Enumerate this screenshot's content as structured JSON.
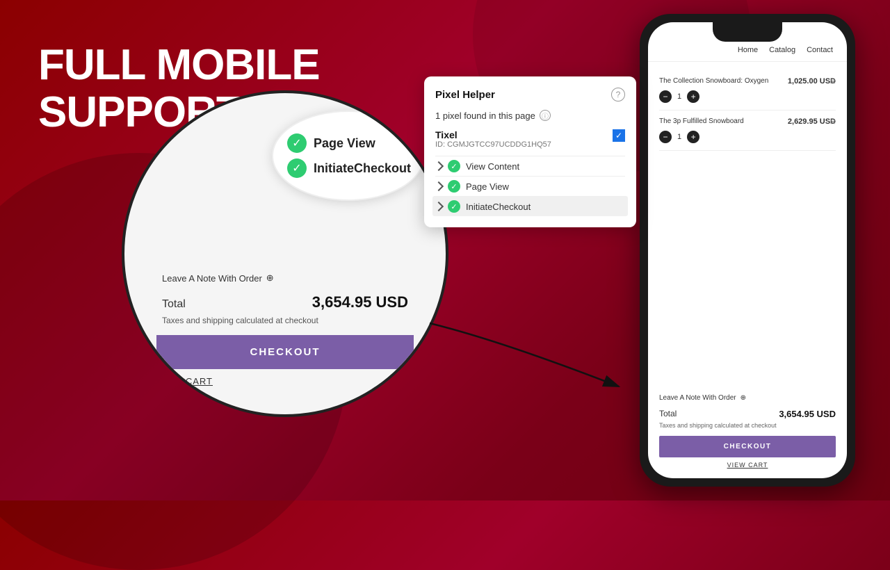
{
  "page": {
    "background": "#8b0000",
    "headline_line1": "FULL MOBILE",
    "headline_line2": "SUPPORT"
  },
  "pixel_helper": {
    "title": "Pixel Helper",
    "info_icon": "ⓘ",
    "pixel_count_text": "1 pixel found in this page",
    "tixel": {
      "name": "Tixel",
      "id": "ID: CGMJGTCC97UCDDG1HQ57"
    },
    "events": [
      {
        "label": "View Content",
        "active": true
      },
      {
        "label": "Page View",
        "active": true
      },
      {
        "label": "InitiateCheckout",
        "active": true,
        "highlighted": true
      }
    ]
  },
  "zoom_bubble": {
    "items": [
      {
        "label": "Page View"
      },
      {
        "label": "InitiateCheckout"
      }
    ]
  },
  "circle_cart": {
    "leave_note": "Leave A Note With Order",
    "total_label": "Total",
    "total_value": "3,654.95 USD",
    "tax_note": "Taxes and shipping calculated at checkout",
    "checkout_btn": "CHECKOUT",
    "view_cart_btn": "VIEW CART"
  },
  "phone": {
    "nav_items": [
      "Home",
      "Catalog",
      "Contact"
    ],
    "products": [
      {
        "name": "The Collection Snowboard: Oxygen",
        "qty": 1,
        "price": "1,025.00 USD"
      },
      {
        "name": "The 3p Fulfilled Snowboard",
        "qty": 1,
        "price": "2,629.95 USD"
      }
    ],
    "leave_note": "Leave A Note With Order",
    "total_label": "Total",
    "total_value": "3,654.95 USD",
    "tax_note": "Taxes and shipping calculated at checkout",
    "checkout_btn": "CHECKOUT",
    "view_cart_btn": "VIEW CART"
  }
}
